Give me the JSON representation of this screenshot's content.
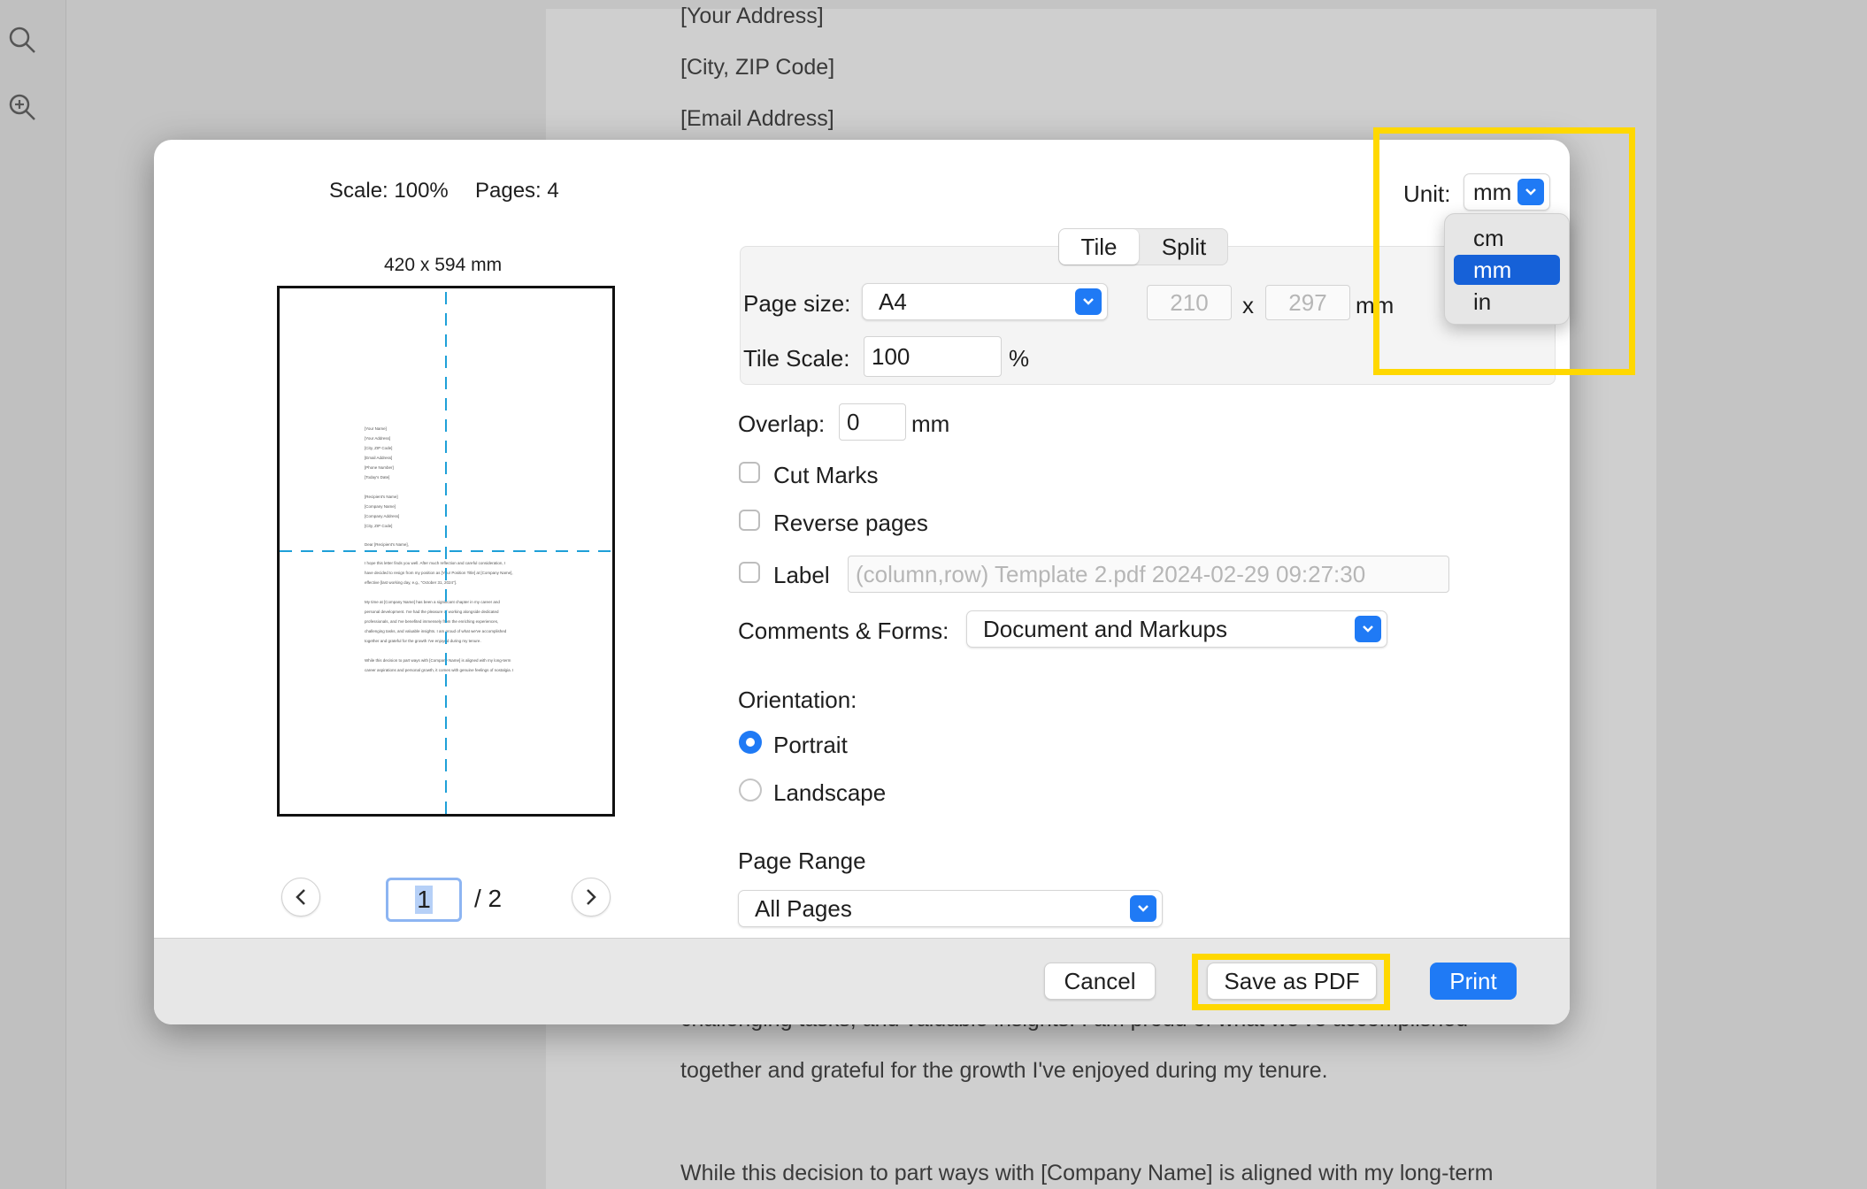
{
  "background_doc": {
    "lines_top": [
      "[Your Address]",
      "[City, ZIP Code]",
      "[Email Address]"
    ],
    "lines_bottom": [
      "challenging tasks, and valuable insights. I am proud of what we've accomplished",
      "together and grateful for the growth I've enjoyed during my tenure.",
      "While this decision to part ways with [Company Name] is aligned with my long-term"
    ]
  },
  "sidebar": {
    "icons": [
      "search-icon",
      "zoom-in-icon"
    ]
  },
  "dialog": {
    "scale_text": "Scale: 100%",
    "pages_text": "Pages: 4",
    "preview_size": "420 x 594 mm",
    "preview_lines": [
      "[Your Name]",
      "[Your Address]",
      "[City, ZIP Code]",
      "[Email Address]",
      "[Phone Number]",
      "[Today's Date]",
      "[Recipient's Name]",
      "[Company Name]",
      "[Company Address]",
      "[City, ZIP Code]",
      "Dear [Recipient's Name],",
      "I hope this letter finds you well. After much reflection and careful consideration, I",
      "have decided to resign from my position as [Your Position Title] at [Company Name],",
      "effective [last working day, e.g., \"October 31, 2024\"].",
      "My time at [Company Name] has been a significant chapter in my career and",
      "personal development. I've had the pleasure of working alongside dedicated",
      "professionals, and I've benefited immensely from the enriching experiences,",
      "challenging tasks, and valuable insights. I am proud of what we've accomplished",
      "together and grateful for the growth I've enjoyed during my tenure.",
      "While this decision to part ways with [Company Name] is aligned with my long-term",
      "career aspirations and personal growth, it comes with genuine feelings of nostalgia. I"
    ],
    "page_current": "1",
    "page_total": "/ 2",
    "unit_label": "Unit:",
    "unit_value": "mm",
    "unit_options": [
      "cm",
      "mm",
      "in"
    ],
    "unit_selected": "mm",
    "tabs": [
      "Tile",
      "Split"
    ],
    "active_tab": "Tile",
    "page_size_label": "Page size:",
    "page_size_value": "A4",
    "width_value": "210",
    "x_sep": "x",
    "height_value": "297",
    "size_unit": "mm",
    "tile_scale_label": "Tile Scale:",
    "tile_scale_value": "100",
    "percent": "%",
    "overlap_label": "Overlap:",
    "overlap_value": "0",
    "overlap_unit": "mm",
    "cut_marks": "Cut Marks",
    "reverse_pages": "Reverse pages",
    "label_label": "Label",
    "label_placeholder": "(column,row) Template 2.pdf 2024-02-29 09:27:30",
    "comments_label": "Comments & Forms:",
    "comments_value": "Document and Markups",
    "orientation_label": "Orientation:",
    "portrait": "Portrait",
    "landscape": "Landscape",
    "orientation_selected": "Portrait",
    "page_range_label": "Page Range",
    "page_range_value": "All Pages",
    "cancel": "Cancel",
    "save_pdf": "Save as PDF",
    "print": "Print"
  },
  "colors": {
    "accent": "#1f7af5",
    "highlight": "#ffd800",
    "guide": "#1ea0d8"
  }
}
